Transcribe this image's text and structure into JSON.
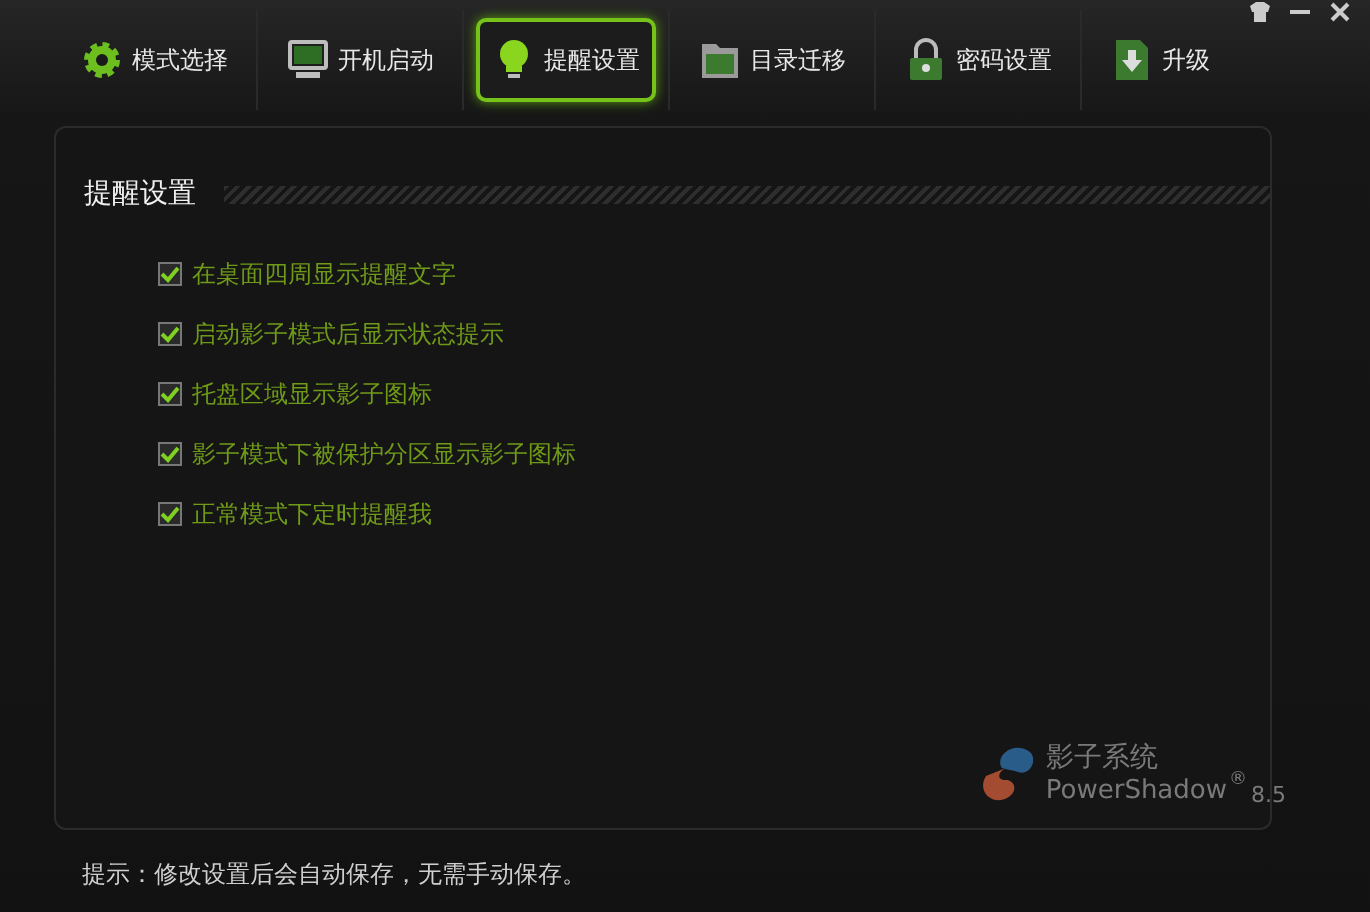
{
  "tabs": [
    {
      "label": "模式选择",
      "kind": "gear",
      "selected": false
    },
    {
      "label": "开机启动",
      "kind": "monitor",
      "selected": false
    },
    {
      "label": "提醒设置",
      "kind": "bulb",
      "selected": true
    },
    {
      "label": "目录迁移",
      "kind": "folder",
      "selected": false
    },
    {
      "label": "密码设置",
      "kind": "lock",
      "selected": false
    },
    {
      "label": "升级",
      "kind": "upgrade",
      "selected": false
    }
  ],
  "panel": {
    "title": "提醒设置",
    "options": [
      {
        "label": "在桌面四周显示提醒文字",
        "checked": true
      },
      {
        "label": "启动影子模式后显示状态提示",
        "checked": true
      },
      {
        "label": "托盘区域显示影子图标",
        "checked": true
      },
      {
        "label": "影子模式下被保护分区显示影子图标",
        "checked": true
      },
      {
        "label": "正常模式下定时提醒我",
        "checked": true
      }
    ]
  },
  "logo": {
    "name": "影子系统",
    "product": "PowerShadow",
    "mark": "®",
    "version": "8.5"
  },
  "hint": "提示：修改设置后会自动保存，无需手动保存。"
}
